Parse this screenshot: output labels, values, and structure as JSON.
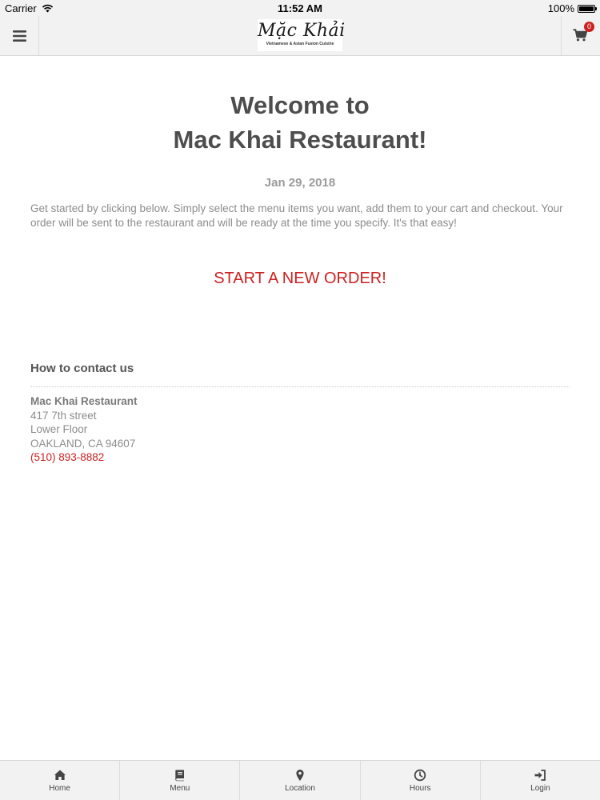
{
  "status_bar": {
    "carrier": "Carrier",
    "time": "11:52 AM",
    "battery": "100%",
    "battery_level": 1.0
  },
  "nav": {
    "logo_title": "Mặc Khải",
    "logo_subtitle": "Vietnamese & Asian Fusion Cuisine",
    "cart_count": "0",
    "icons": {
      "menu": "hamburger-icon",
      "cart": "cart-icon"
    }
  },
  "main": {
    "welcome_line1": "Welcome to",
    "welcome_line2": "Mac Khai Restaurant!",
    "date": "Jan 29, 2018",
    "intro": "Get started by clicking below. Simply select the menu items you want, add them to your cart and checkout. Your order will be sent to the restaurant and will be ready at the time you specify. It's that easy!",
    "start_order_label": "START A NEW ORDER!"
  },
  "contact": {
    "heading": "How to contact us",
    "name": "Mac Khai Restaurant",
    "address_line1": "417 7th street",
    "address_line2": "Lower Floor",
    "address_line3": "OAKLAND, CA 94607",
    "phone": "(510) 893-8882"
  },
  "tabs": [
    {
      "label": "Home",
      "icon": "home-icon"
    },
    {
      "label": "Menu",
      "icon": "book-icon"
    },
    {
      "label": "Location",
      "icon": "map-marker-icon"
    },
    {
      "label": "Hours",
      "icon": "clock-icon"
    },
    {
      "label": "Login",
      "icon": "sign-in-icon"
    }
  ],
  "colors": {
    "accent_red": "#cc2222",
    "bar_background": "#f2f2f2",
    "heading_text": "#4d4d4d",
    "body_text": "#8c8c8c"
  }
}
